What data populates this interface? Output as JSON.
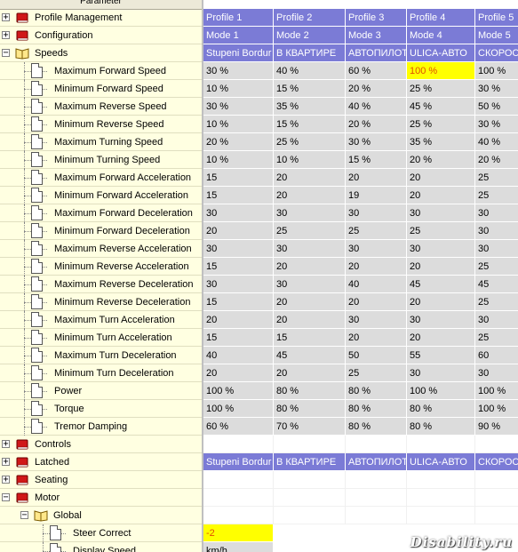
{
  "tree": {
    "header": "Parameter",
    "rows": [
      {
        "label": "Profile Management",
        "type": "folder",
        "level": 0,
        "expander": "+"
      },
      {
        "label": "Configuration",
        "type": "folder",
        "level": 0,
        "expander": "+"
      },
      {
        "label": "Speeds",
        "type": "open-folder",
        "level": 0,
        "expander": "−"
      },
      {
        "label": "Maximum Forward Speed",
        "type": "param",
        "level": 1
      },
      {
        "label": "Minimum Forward Speed",
        "type": "param",
        "level": 1
      },
      {
        "label": "Maximum Reverse Speed",
        "type": "param",
        "level": 1
      },
      {
        "label": "Minimum Reverse Speed",
        "type": "param",
        "level": 1
      },
      {
        "label": "Maximum Turning Speed",
        "type": "param",
        "level": 1
      },
      {
        "label": "Minimum Turning Speed",
        "type": "param",
        "level": 1
      },
      {
        "label": "Maximum Forward Acceleration",
        "type": "param",
        "level": 1
      },
      {
        "label": "Minimum Forward Acceleration",
        "type": "param",
        "level": 1
      },
      {
        "label": "Maximum Forward Deceleration",
        "type": "param",
        "level": 1
      },
      {
        "label": "Minimum Forward Deceleration",
        "type": "param",
        "level": 1
      },
      {
        "label": "Maximum Reverse Acceleration",
        "type": "param",
        "level": 1
      },
      {
        "label": "Minimum Reverse Acceleration",
        "type": "param",
        "level": 1
      },
      {
        "label": "Maximum Reverse Deceleration",
        "type": "param",
        "level": 1
      },
      {
        "label": "Minimum Reverse Deceleration",
        "type": "param",
        "level": 1
      },
      {
        "label": "Maximum Turn Acceleration",
        "type": "param",
        "level": 1
      },
      {
        "label": "Minimum Turn Acceleration",
        "type": "param",
        "level": 1
      },
      {
        "label": "Maximum Turn Deceleration",
        "type": "param",
        "level": 1
      },
      {
        "label": "Minimum Turn Deceleration",
        "type": "param",
        "level": 1
      },
      {
        "label": "Power",
        "type": "param",
        "level": 1
      },
      {
        "label": "Torque",
        "type": "param",
        "level": 1
      },
      {
        "label": "Tremor Damping",
        "type": "param",
        "level": 1
      },
      {
        "label": "Controls",
        "type": "folder",
        "level": 0,
        "expander": "+"
      },
      {
        "label": "Latched",
        "type": "folder",
        "level": 0,
        "expander": "+"
      },
      {
        "label": "Seating",
        "type": "folder",
        "level": 0,
        "expander": "+"
      },
      {
        "label": "Motor",
        "type": "folder",
        "level": 0,
        "expander": "−"
      },
      {
        "label": "Global",
        "type": "open-folder",
        "level": 1,
        "expander": "−"
      },
      {
        "label": "Steer Correct",
        "type": "param",
        "level": 2
      },
      {
        "label": "Display Speed",
        "type": "param",
        "level": 2
      }
    ]
  },
  "grid": {
    "rows": [
      {
        "style": "blue",
        "cells": [
          "Profile 1",
          "Profile 2",
          "Profile 3",
          "Profile 4",
          "Profile 5"
        ]
      },
      {
        "style": "blue",
        "cells": [
          "Mode 1",
          "Mode 2",
          "Mode 3",
          "Mode 4",
          "Mode 5"
        ]
      },
      {
        "style": "blue",
        "cells": [
          "Stupeni Bordur",
          "В КВАРТИРЕ",
          "АВТОПИЛОТ",
          "ULICA-АВТО",
          "СКОРОСТЬ"
        ]
      },
      {
        "style": "gray",
        "cells": [
          "30 %",
          "40 %",
          "60 %",
          "100 %",
          "100 %"
        ],
        "highlight": 3
      },
      {
        "style": "gray",
        "cells": [
          "10 %",
          "15 %",
          "20 %",
          "25 %",
          "30 %"
        ]
      },
      {
        "style": "gray",
        "cells": [
          "30 %",
          "35 %",
          "40 %",
          "45 %",
          "50 %"
        ]
      },
      {
        "style": "gray",
        "cells": [
          "10 %",
          "15 %",
          "20 %",
          "25 %",
          "30 %"
        ]
      },
      {
        "style": "gray",
        "cells": [
          "20 %",
          "25 %",
          "30 %",
          "35 %",
          "40 %"
        ]
      },
      {
        "style": "gray",
        "cells": [
          "10 %",
          "10 %",
          "15 %",
          "20 %",
          "20 %"
        ]
      },
      {
        "style": "gray",
        "cells": [
          "15",
          "20",
          "20",
          "20",
          "25"
        ]
      },
      {
        "style": "gray",
        "cells": [
          "15",
          "20",
          "19",
          "20",
          "25"
        ]
      },
      {
        "style": "gray",
        "cells": [
          "30",
          "30",
          "30",
          "30",
          "30"
        ]
      },
      {
        "style": "gray",
        "cells": [
          "20",
          "25",
          "25",
          "25",
          "30"
        ]
      },
      {
        "style": "gray",
        "cells": [
          "30",
          "30",
          "30",
          "30",
          "30"
        ]
      },
      {
        "style": "gray",
        "cells": [
          "15",
          "20",
          "20",
          "20",
          "25"
        ]
      },
      {
        "style": "gray",
        "cells": [
          "30",
          "30",
          "40",
          "45",
          "45"
        ]
      },
      {
        "style": "gray",
        "cells": [
          "15",
          "20",
          "20",
          "20",
          "25"
        ]
      },
      {
        "style": "gray",
        "cells": [
          "20",
          "20",
          "30",
          "30",
          "30"
        ]
      },
      {
        "style": "gray",
        "cells": [
          "15",
          "15",
          "20",
          "20",
          "25"
        ]
      },
      {
        "style": "gray",
        "cells": [
          "40",
          "45",
          "50",
          "55",
          "60"
        ]
      },
      {
        "style": "gray",
        "cells": [
          "20",
          "20",
          "25",
          "30",
          "30"
        ]
      },
      {
        "style": "gray",
        "cells": [
          "100 %",
          "80 %",
          "80 %",
          "100 %",
          "100 %"
        ]
      },
      {
        "style": "gray",
        "cells": [
          "100 %",
          "80 %",
          "80 %",
          "80 %",
          "100 %"
        ]
      },
      {
        "style": "gray",
        "cells": [
          "60 %",
          "70 %",
          "80 %",
          "80 %",
          "90 %"
        ]
      },
      {
        "style": "white",
        "cells": [
          "",
          "",
          "",
          "",
          ""
        ]
      },
      {
        "style": "blue",
        "cells": [
          "Stupeni Bordur",
          "В КВАРТИРЕ",
          "АВТОПИЛОТ",
          "ULICA-АВТО",
          "СКОРОСТЬ"
        ]
      },
      {
        "style": "white",
        "cells": [
          "",
          "",
          "",
          "",
          ""
        ]
      },
      {
        "style": "white",
        "cells": [
          "",
          "",
          "",
          "",
          ""
        ]
      },
      {
        "style": "white",
        "cells": [
          "",
          "",
          "",
          "",
          ""
        ]
      },
      {
        "style": "single",
        "cells": [
          "-2"
        ],
        "singleClass": "yellow orange"
      },
      {
        "style": "single",
        "cells": [
          "km/h"
        ],
        "singleClass": "gray"
      }
    ]
  },
  "watermark": "Disability.ru",
  "colors": {
    "header_blue": "#7b7bd6",
    "cell_gray": "#dcdcdc",
    "highlight": "#ffff00",
    "tree_bg": "#ffffe1"
  }
}
